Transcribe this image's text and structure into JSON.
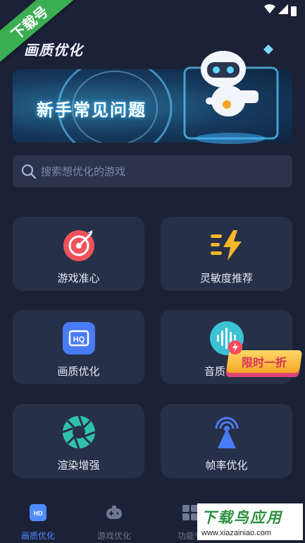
{
  "overlay": {
    "corner_ribbon": "下载号",
    "watermark_title": "下载鸟应用",
    "watermark_url": "www.xiazainiao.com"
  },
  "header": {
    "title": "画质优化"
  },
  "banner": {
    "text": "新手常见问题"
  },
  "search": {
    "placeholder": "搜索想优化的游戏"
  },
  "cards": [
    {
      "label": "游戏准心",
      "icon": "crosshair-target-icon",
      "color": "#f0535b"
    },
    {
      "label": "灵敏度推荐",
      "icon": "lightning-speed-icon",
      "color": "#f4b62a"
    },
    {
      "label": "画质优化",
      "icon": "hq-icon",
      "color": "#4a7bf7"
    },
    {
      "label": "音质",
      "icon": "sound-wave-icon",
      "color": "#3bc2d4"
    },
    {
      "label": "渲染增强",
      "icon": "aperture-icon",
      "color": "#2fc2a8"
    },
    {
      "label": "帧率优化",
      "icon": "signal-tower-icon",
      "color": "#4a7bf7"
    }
  ],
  "promo": {
    "text": "限时一折"
  },
  "bottom_nav": [
    {
      "label": "画质优化",
      "icon": "hd-icon",
      "active": true
    },
    {
      "label": "游戏优化",
      "icon": "gamepad-icon",
      "active": false
    },
    {
      "label": "功能专",
      "icon": "grid-icon",
      "active": false
    }
  ],
  "colors": {
    "background": "#1b2136",
    "card": "#273049",
    "accent": "#4f8cff"
  }
}
